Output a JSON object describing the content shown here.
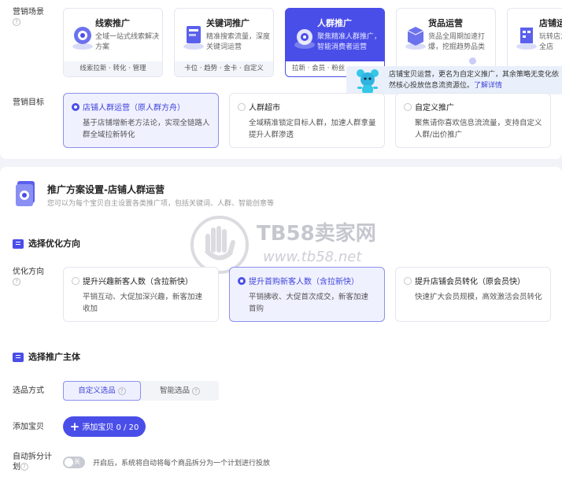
{
  "scene": {
    "label": "营销场景",
    "cards": [
      {
        "title": "线索推广",
        "desc": "全域一站式线索解决方案",
        "footer": "线索拉新 · 转化 · 管理"
      },
      {
        "title": "关键词推广",
        "desc": "精准搜索流量，深度关键词运营",
        "footer": "卡位 · 趋势 · 金卡 · 自定义"
      },
      {
        "title": "人群推广",
        "desc": "聚焦精准人群推广，智能消费者运营",
        "footer": "拉新 · 会员 · 粉丝"
      },
      {
        "title": "货品运营",
        "desc": "货品全周期加速打爆，挖掘趋势品类",
        "footer": ""
      },
      {
        "title": "店铺运",
        "desc": "玩转店力全店",
        "footer": ""
      }
    ]
  },
  "tooltip": {
    "text": "店铺宝贝运营，更名为自定义推广，其余策略无变化依然核心投放信息流资源位。",
    "link": "了解详情"
  },
  "goal": {
    "label": "营销目标",
    "options": [
      {
        "title": "店铺人群运营（原人群方舟）",
        "desc": "基于店铺增新老方法论，实现全链路人群全域拉新转化"
      },
      {
        "title": "人群超市",
        "desc": "全域精准锁定目标人群，加速人群拿量提升人群渗透"
      },
      {
        "title": "自定义推广",
        "desc": "聚焦请你喜欢信息流流量，支持自定义人群/出价推广"
      }
    ]
  },
  "plan": {
    "title": "推广方案设置-店铺人群运营",
    "subtitle": "您可以为每个宝贝自主设置各类推广项，包括关键词、人群、智能创意等"
  },
  "watermark": {
    "brand": "TB58卖家网",
    "url": "www.tb58.net"
  },
  "direction": {
    "section": "选择优化方向",
    "label": "优化方向",
    "options": [
      {
        "title": "提升兴趣新客人数（含拉新快）",
        "desc": "平销互动、大促加深兴趣，新客加速收加"
      },
      {
        "title": "提升首购新客人数（含拉新快）",
        "desc": "平销拂收、大促首次成交，新客加速首购"
      },
      {
        "title": "提升店铺会员转化（原会员快）",
        "desc": "快速扩大会员规模，高效激活会员转化"
      }
    ]
  },
  "subject": {
    "section": "选择推广主体",
    "method_label": "选品方式",
    "method_tabs": [
      "自定义选品",
      "智能选品"
    ],
    "add_label": "添加宝贝",
    "add_button": "添加宝贝 0 / 20",
    "split_label": "自动拆分计划",
    "toggle_text": "关",
    "split_hint": "开启后，系统将自动将每个商品拆分为一个计划进行投放"
  },
  "colors": {
    "accent": "#4a4ee8"
  }
}
